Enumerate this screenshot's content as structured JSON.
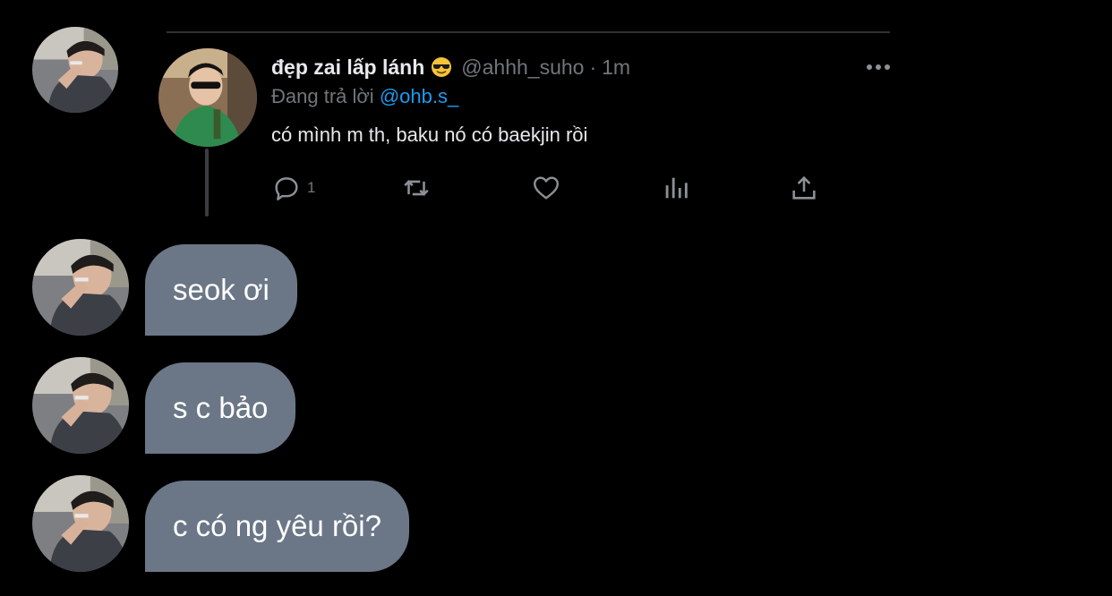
{
  "tweet": {
    "display_name": "đẹp zai lấp lánh",
    "emoji": "smiling-face-with-sunglasses",
    "handle": "@ahhh_suho",
    "separator": "·",
    "time": "1m",
    "replying_prefix": "Đang trả lời",
    "replying_to": "@ohb.s_",
    "text": "có mình m th, baku nó có baekjin rồi",
    "actions": {
      "reply_icon": "reply-icon",
      "reply_count": "1",
      "retweet_icon": "retweet-icon",
      "like_icon": "heart-icon",
      "views_icon": "analytics-icon",
      "share_icon": "share-icon"
    },
    "more_icon": "more-icon"
  },
  "messages": [
    {
      "text": "seok ơi"
    },
    {
      "text": "s c bảo"
    },
    {
      "text": "c có ng yêu rồi?"
    }
  ],
  "colors": {
    "background": "#000000",
    "bubble": "#6b7787",
    "mention": "#1d9bf0",
    "muted": "#71767b"
  }
}
